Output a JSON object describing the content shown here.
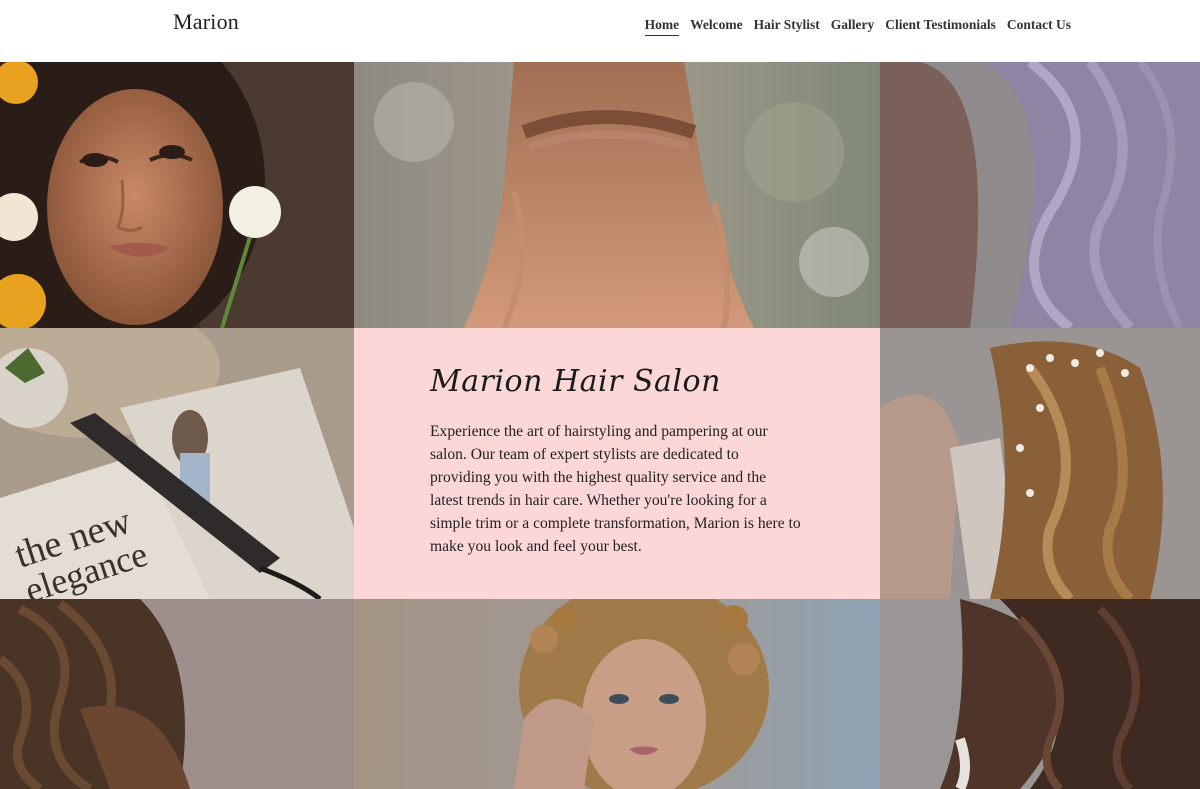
{
  "header": {
    "brand": "Marion",
    "nav": [
      {
        "label": "Home",
        "active": true
      },
      {
        "label": "Welcome",
        "active": false
      },
      {
        "label": "Hair Stylist",
        "active": false
      },
      {
        "label": "Gallery",
        "active": false
      },
      {
        "label": "Client Testimonials",
        "active": false
      },
      {
        "label": "Contact Us",
        "active": false
      }
    ]
  },
  "hero": {
    "title": "Marion Hair Salon",
    "description": "Experience the art of hairstyling and pampering at our salon. Our team of expert stylists are dedicated to providing you with the highest quality service and the latest trends in hair care. Whether you're looking for a simple trim or a complete transformation, Marion is here to make you look and feel your best."
  },
  "colors": {
    "panel_background": "#fbd7d7",
    "header_background": "#ffffff",
    "text": "#222222"
  },
  "gallery": {
    "images": [
      "photo-woman-with-flowers",
      "photo-braided-blonde-hair",
      "photo-lavender-wavy-hair",
      "photo-flat-iron-on-magazine",
      "photo-wavy-hair-with-hairpiece",
      "photo-box-braids",
      "photo-curly-blonde-woman",
      "photo-brown-wavy-hair"
    ],
    "magazine_text": "the new elegance"
  }
}
